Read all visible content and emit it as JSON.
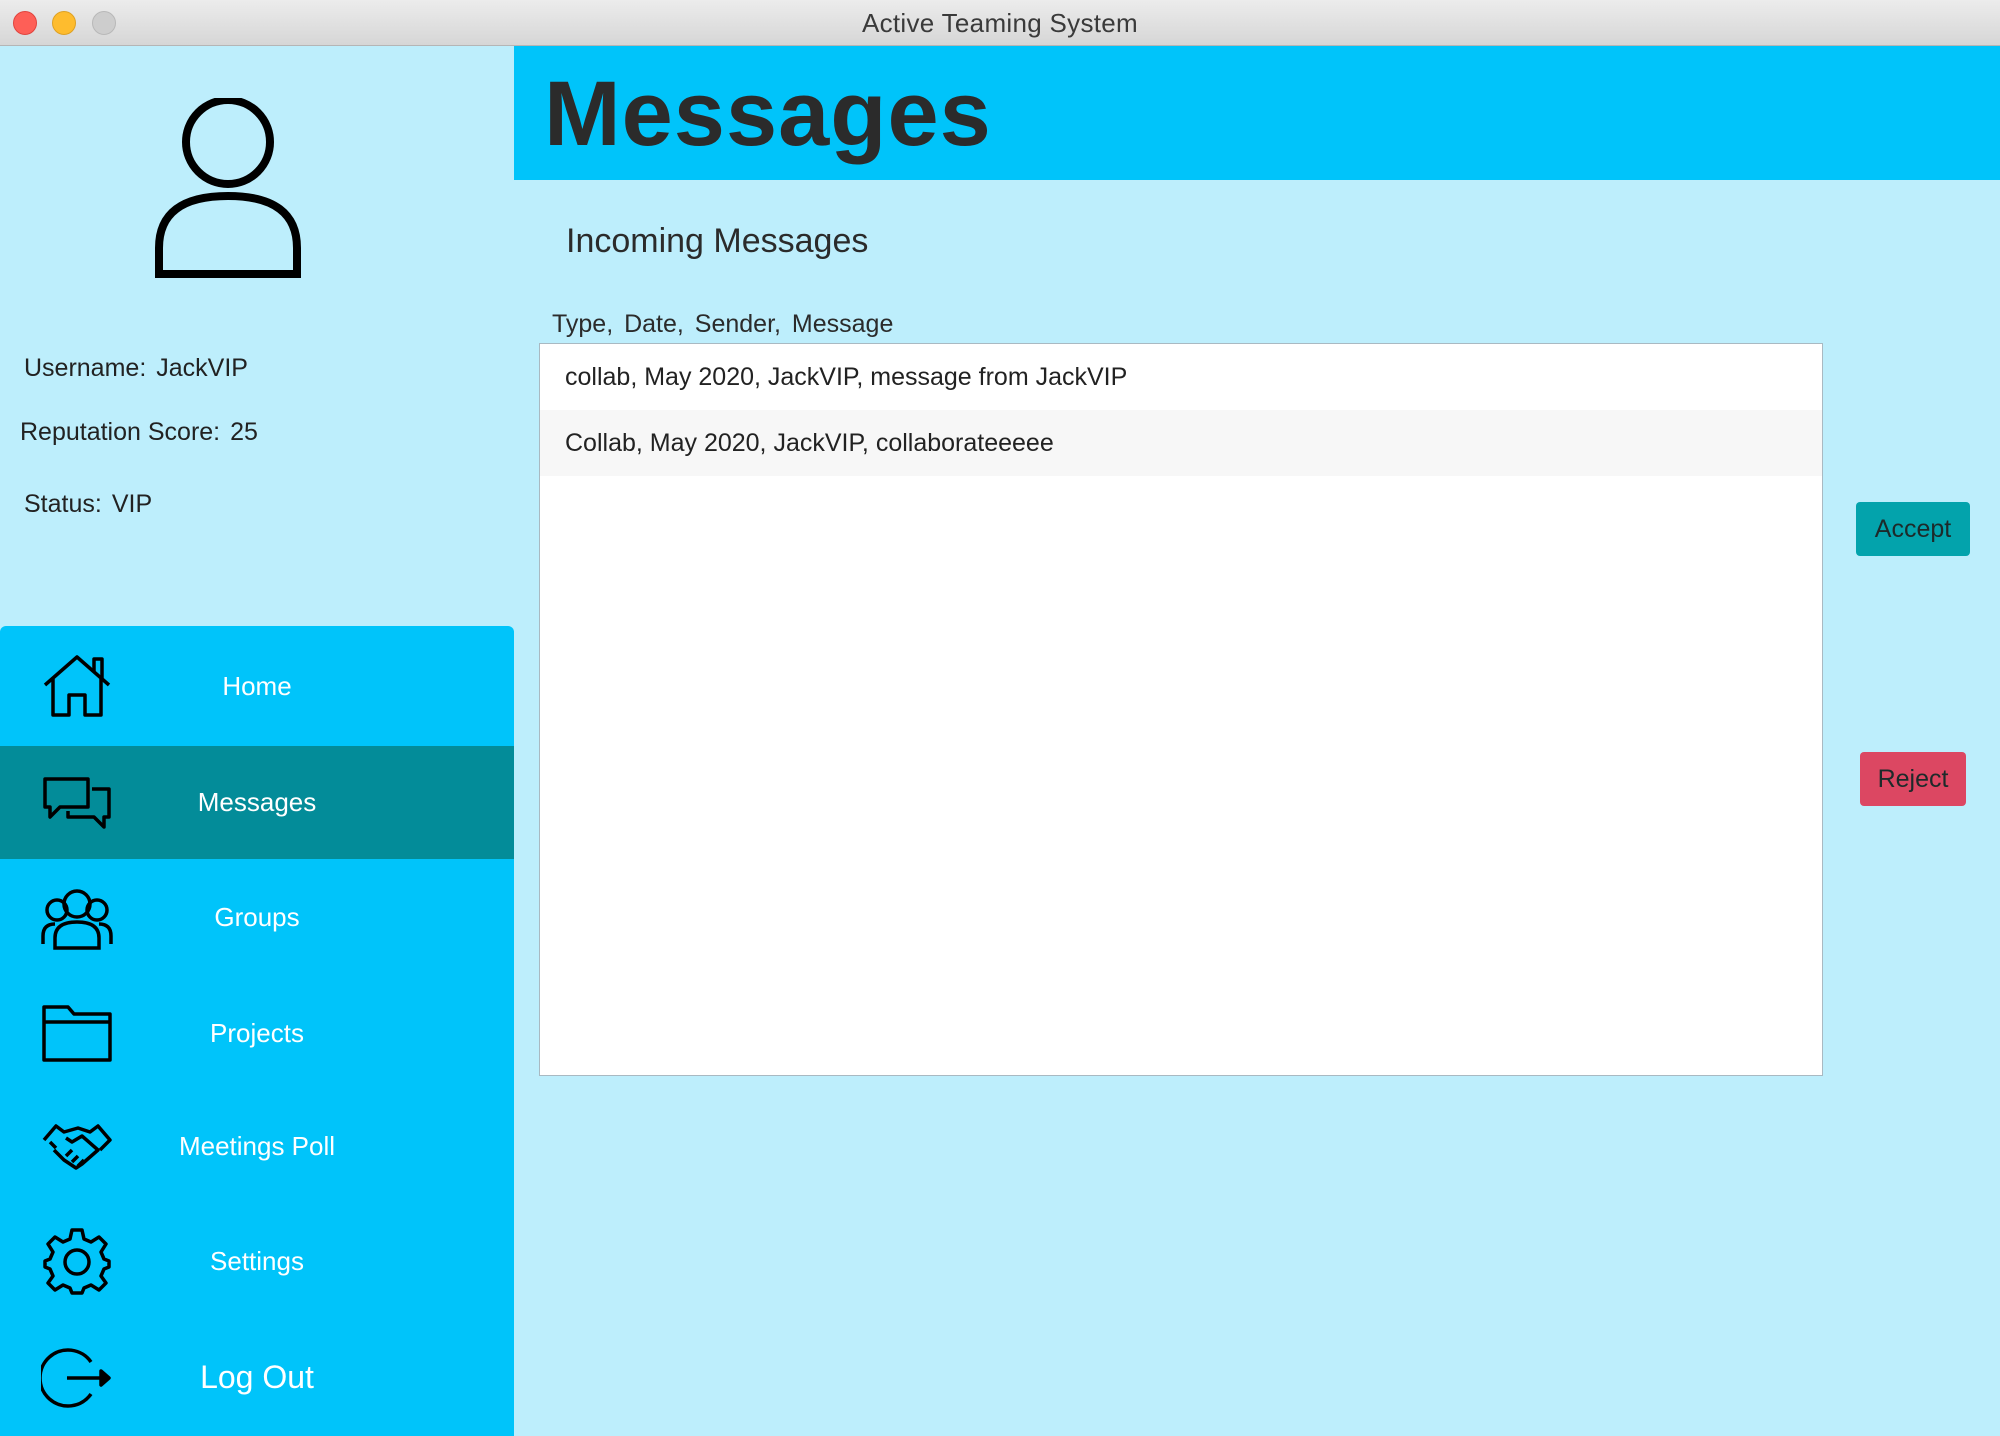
{
  "window": {
    "title": "Active Teaming System"
  },
  "profile": {
    "username_label": "Username:",
    "username": "JackVIP",
    "reputation_label": "Reputation Score:",
    "reputation": "25",
    "status_label": "Status:",
    "status": "VIP"
  },
  "nav": {
    "items": [
      {
        "label": "Home",
        "icon": "home-icon"
      },
      {
        "label": "Messages",
        "icon": "chat-bubbles-icon",
        "active": true
      },
      {
        "label": "Groups",
        "icon": "users-icon"
      },
      {
        "label": "Projects",
        "icon": "folder-icon"
      },
      {
        "label": "Meetings Poll",
        "icon": "handshake-icon"
      },
      {
        "label": "Settings",
        "icon": "gear-icon"
      },
      {
        "label": "Log Out",
        "icon": "logout-icon"
      }
    ]
  },
  "header": {
    "title": "Messages"
  },
  "messages": {
    "section_title": "Incoming Messages",
    "column_header": "Type,  Date,  Sender,  Message",
    "rows": [
      "collab, May 2020, JackVIP, message from JackVIP",
      "Collab, May 2020, JackVIP, collaborateeeee"
    ]
  },
  "actions": {
    "accept_label": "Accept",
    "reject_label": "Reject"
  },
  "colors": {
    "background": "#bdeefc",
    "accent": "#00c4fa",
    "active_nav": "#038c99",
    "accept": "#03a3ac",
    "reject": "#dc4762"
  }
}
